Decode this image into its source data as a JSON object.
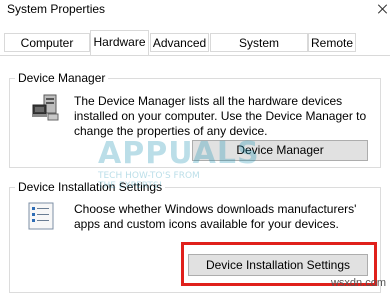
{
  "window": {
    "title": "System Properties"
  },
  "tabs": [
    {
      "label": "Computer Name"
    },
    {
      "label": "Hardware",
      "active": true
    },
    {
      "label": "Advanced"
    },
    {
      "label": "System Protection"
    },
    {
      "label": "Remote"
    }
  ],
  "device_manager": {
    "group_title": "Device Manager",
    "description": "The Device Manager lists all the hardware devices installed on your computer. Use the Device Manager to change the properties of any device.",
    "button_label": "Device Manager",
    "icon": "computer-devices-icon"
  },
  "install_settings": {
    "group_title": "Device Installation Settings",
    "description": "Choose whether Windows downloads manufacturers' apps and custom icons available for your devices.",
    "button_label": "Device Installation Settings",
    "icon": "checklist-icon"
  },
  "watermark": {
    "brand": "APPUALS",
    "tagline_1": "TECH HOW-TO'S FROM",
    "tagline_2": "THE EXPERTS!"
  },
  "footer_mark": "wsxdn.com",
  "colors": {
    "highlight": "#e0201b",
    "button_face": "#e1e1e1",
    "border": "#d9d9d9"
  }
}
